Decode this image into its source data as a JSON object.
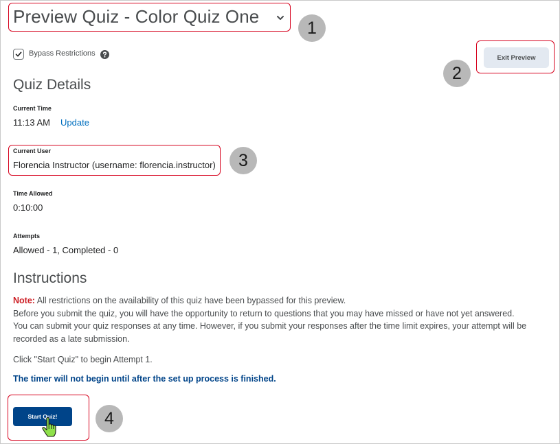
{
  "header": {
    "title": "Preview Quiz - Color Quiz One"
  },
  "bypass": {
    "label": "Bypass Restrictions",
    "checked": true
  },
  "exit_preview": {
    "label": "Exit Preview"
  },
  "details": {
    "heading": "Quiz Details",
    "current_time": {
      "label": "Current Time",
      "value": "11:13 AM",
      "action": "Update"
    },
    "current_user": {
      "label": "Current User",
      "value": "Florencia Instructor (username: florencia.instructor)"
    },
    "time_allowed": {
      "label": "Time Allowed",
      "value": "0:10:00"
    },
    "attempts": {
      "label": "Attempts",
      "value": "Allowed - 1, Completed - 0"
    }
  },
  "instructions": {
    "heading": "Instructions",
    "note_label": "Note:",
    "note_text": " All restrictions on the availability of this quiz have been bypassed for this preview.",
    "body_line1": "Before you submit the quiz, you will have the opportunity to return to questions that you may have missed or have not yet answered.",
    "body_line2": "You can submit your quiz responses at any time. However, if you submit your responses after the time limit expires, your attempt will be recorded as a late submission.",
    "start_prompt": "Click \"Start Quiz\" to begin Attempt 1.",
    "timer_message": "The timer will not begin until after the set up process is finished."
  },
  "start_button": {
    "label": "Start Quiz!"
  },
  "callouts": [
    "1",
    "2",
    "3",
    "4"
  ],
  "colors": {
    "highlight": "#d6001c",
    "primary": "#004489",
    "link": "#006fbf",
    "note": "#cd2026",
    "callout_badge": "#b8b8b8"
  }
}
